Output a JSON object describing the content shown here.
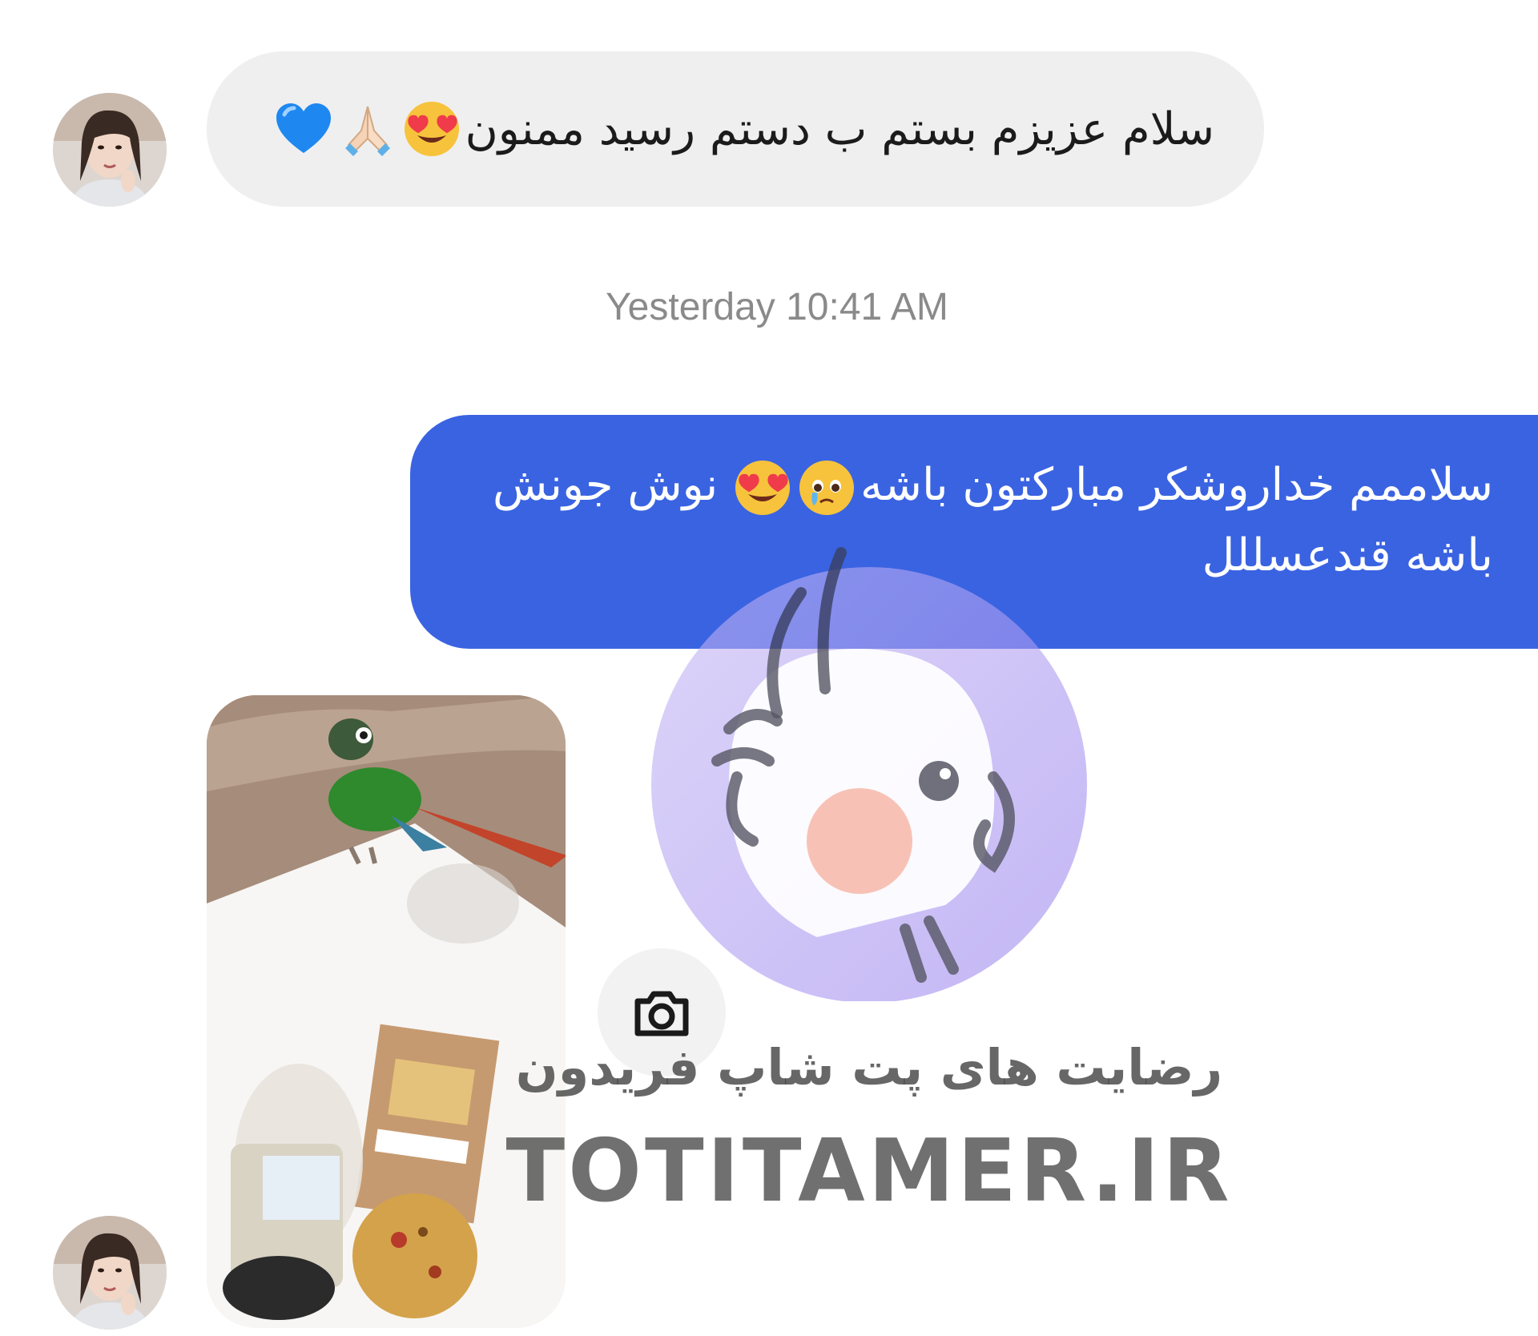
{
  "conversation": {
    "incoming_message": {
      "text": "سلام عزیزم بستم ب دستم رسید ممنون",
      "emojis": [
        "heart-eyes-icon",
        "folded-hands-icon",
        "blue-heart-icon"
      ]
    },
    "timestamp": "Yesterday 10:41 AM",
    "outgoing_message": {
      "text_part1": "سلاممم خداروشکر مبارکتون باشه",
      "text_part2": "نوش جونش",
      "text_part3": "باشه قندعسللل",
      "emojis": [
        "crying-face-icon",
        "heart-eyes-icon"
      ]
    },
    "photo_message": {
      "description_icon": "camera-icon"
    }
  },
  "watermark": {
    "title": "رضایت های پت شاپ فریدون",
    "domain": "TOTITAMER.IR"
  },
  "colors": {
    "outgoing_bubble": "#3a63e2",
    "incoming_bubble": "#efefef",
    "timestamp": "#8a8a8a"
  }
}
